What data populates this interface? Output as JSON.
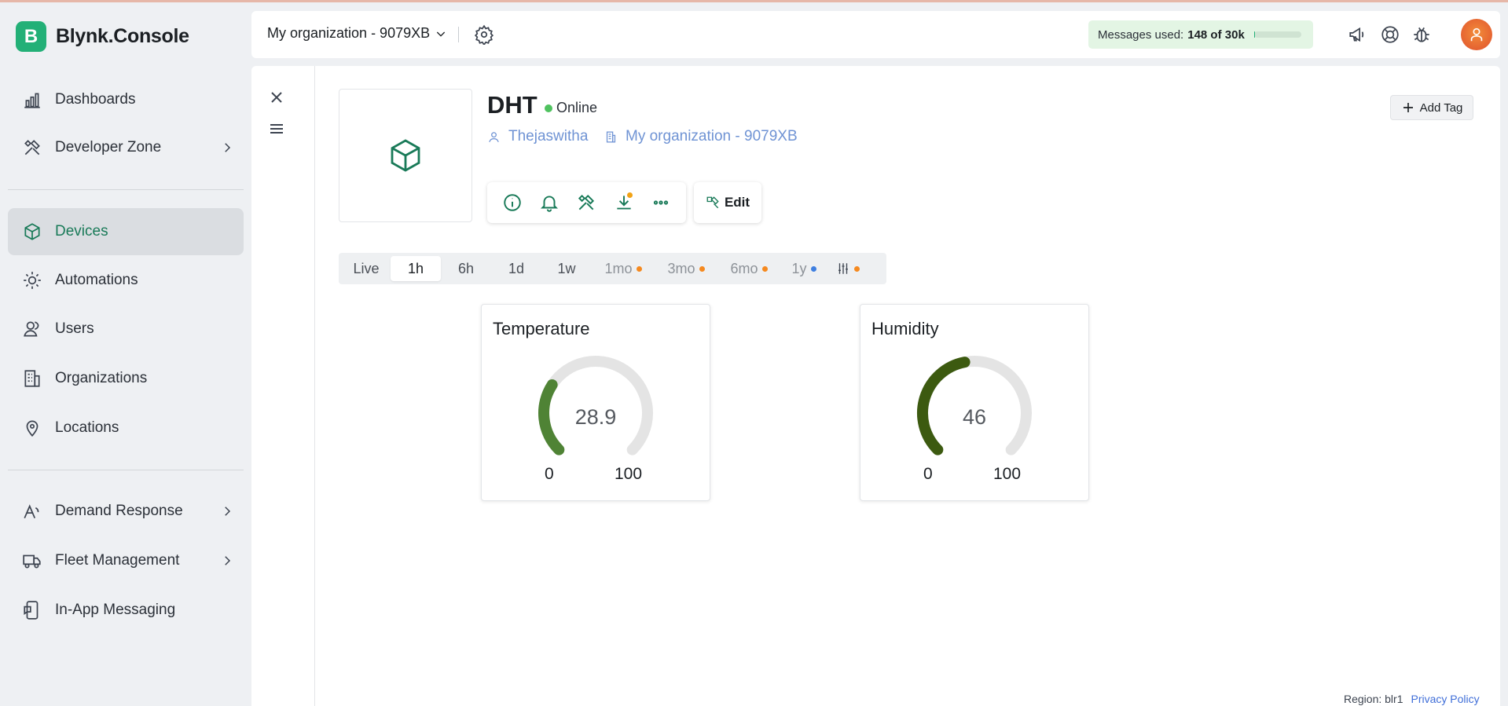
{
  "app": {
    "logo_letter": "B",
    "title": "Blynk.Console"
  },
  "sidebar": {
    "items": [
      {
        "label": "Dashboards",
        "icon": "chart-bar-icon"
      },
      {
        "label": "Developer Zone",
        "icon": "tools-icon",
        "expandable": true
      },
      {
        "label": "Devices",
        "icon": "cube-icon",
        "active": true
      },
      {
        "label": "Automations",
        "icon": "automation-icon"
      },
      {
        "label": "Users",
        "icon": "users-icon"
      },
      {
        "label": "Organizations",
        "icon": "building-icon"
      },
      {
        "label": "Locations",
        "icon": "location-pin-icon"
      },
      {
        "label": "Demand Response",
        "icon": "signal-icon",
        "expandable": true
      },
      {
        "label": "Fleet Management",
        "icon": "truck-icon",
        "expandable": true
      },
      {
        "label": "In-App Messaging",
        "icon": "message-icon"
      }
    ]
  },
  "header": {
    "org_name": "My organization - 9079XB",
    "messages_label": "Messages used:",
    "messages_value": "148 of 30k",
    "messages_used_fraction": 0.005
  },
  "device": {
    "name": "DHT",
    "status": "Online",
    "owner": "Thejaswitha",
    "organization": "My organization - 9079XB",
    "edit_label": "Edit",
    "add_tag_label": "Add Tag"
  },
  "time_ranges": [
    {
      "label": "Live"
    },
    {
      "label": "1h",
      "active": true
    },
    {
      "label": "6h"
    },
    {
      "label": "1d"
    },
    {
      "label": "1w"
    },
    {
      "label": "1mo",
      "dot": "#f5891f",
      "muted": true
    },
    {
      "label": "3mo",
      "dot": "#f5891f",
      "muted": true
    },
    {
      "label": "6mo",
      "dot": "#f5891f",
      "muted": true
    },
    {
      "label": "1y",
      "dot": "#3f7fe0",
      "muted": true
    }
  ],
  "widgets": [
    {
      "title": "Temperature",
      "value": "28.9",
      "min": "0",
      "max": "100",
      "fraction": 0.289,
      "color": "#4f8335"
    },
    {
      "title": "Humidity",
      "value": "46",
      "min": "0",
      "max": "100",
      "fraction": 0.46,
      "color": "#3c5a10"
    }
  ],
  "footer": {
    "region": "Region: blr1",
    "privacy": "Privacy Policy"
  },
  "colors": {
    "accent": "#197a58",
    "brand": "#23b077",
    "link": "#6f93d4"
  }
}
